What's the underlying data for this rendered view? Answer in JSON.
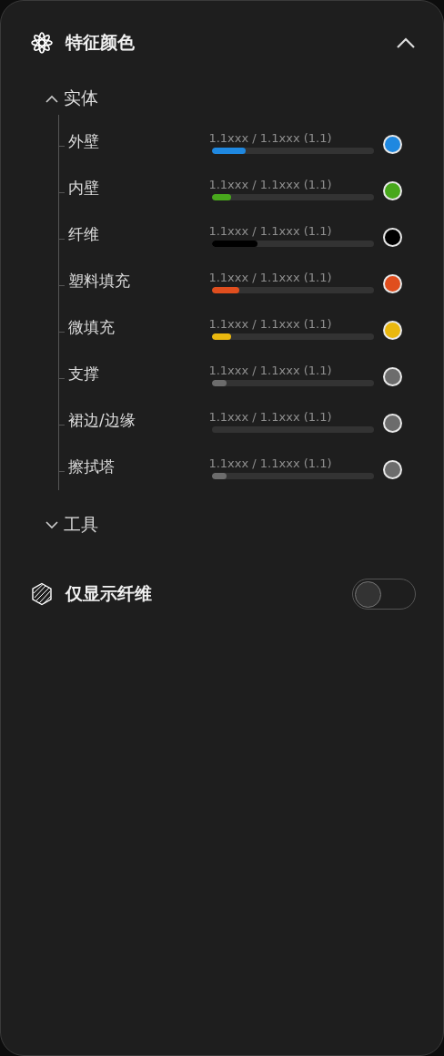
{
  "panel": {
    "title": "特征颜色",
    "expanded": true
  },
  "groups": [
    {
      "label": "实体",
      "expanded": true,
      "items": [
        {
          "label": "外壁",
          "reading": "1.1xxx / 1.1xxx (1.1)",
          "level": 0.21,
          "color": "#1f88e0"
        },
        {
          "label": "内壁",
          "reading": "1.1xxx / 1.1xxx (1.1)",
          "level": 0.12,
          "color": "#48a81c"
        },
        {
          "label": "纤维",
          "reading": "1.1xxx / 1.1xxx (1.1)",
          "level": 0.28,
          "color": "#000000"
        },
        {
          "label": "塑料填充",
          "reading": "1.1xxx / 1.1xxx (1.1)",
          "level": 0.17,
          "color": "#e04e1e"
        },
        {
          "label": "微填充",
          "reading": "1.1xxx / 1.1xxx (1.1)",
          "level": 0.12,
          "color": "#eab80f"
        },
        {
          "label": "支撑",
          "reading": "1.1xxx / 1.1xxx (1.1)",
          "level": 0.09,
          "color": "#6c6c6c"
        },
        {
          "label": "裙边/边缘",
          "reading": "1.1xxx / 1.1xxx (1.1)",
          "color": "#6c6c6c"
        },
        {
          "label": "擦拭塔",
          "reading": "1.1xxx / 1.1xxx (1.1)",
          "level": 0.09,
          "color": "#6c6c6c"
        }
      ]
    },
    {
      "label": "工具",
      "expanded": false
    }
  ],
  "fiber_only": {
    "label": "仅显示纤维",
    "on": false
  }
}
